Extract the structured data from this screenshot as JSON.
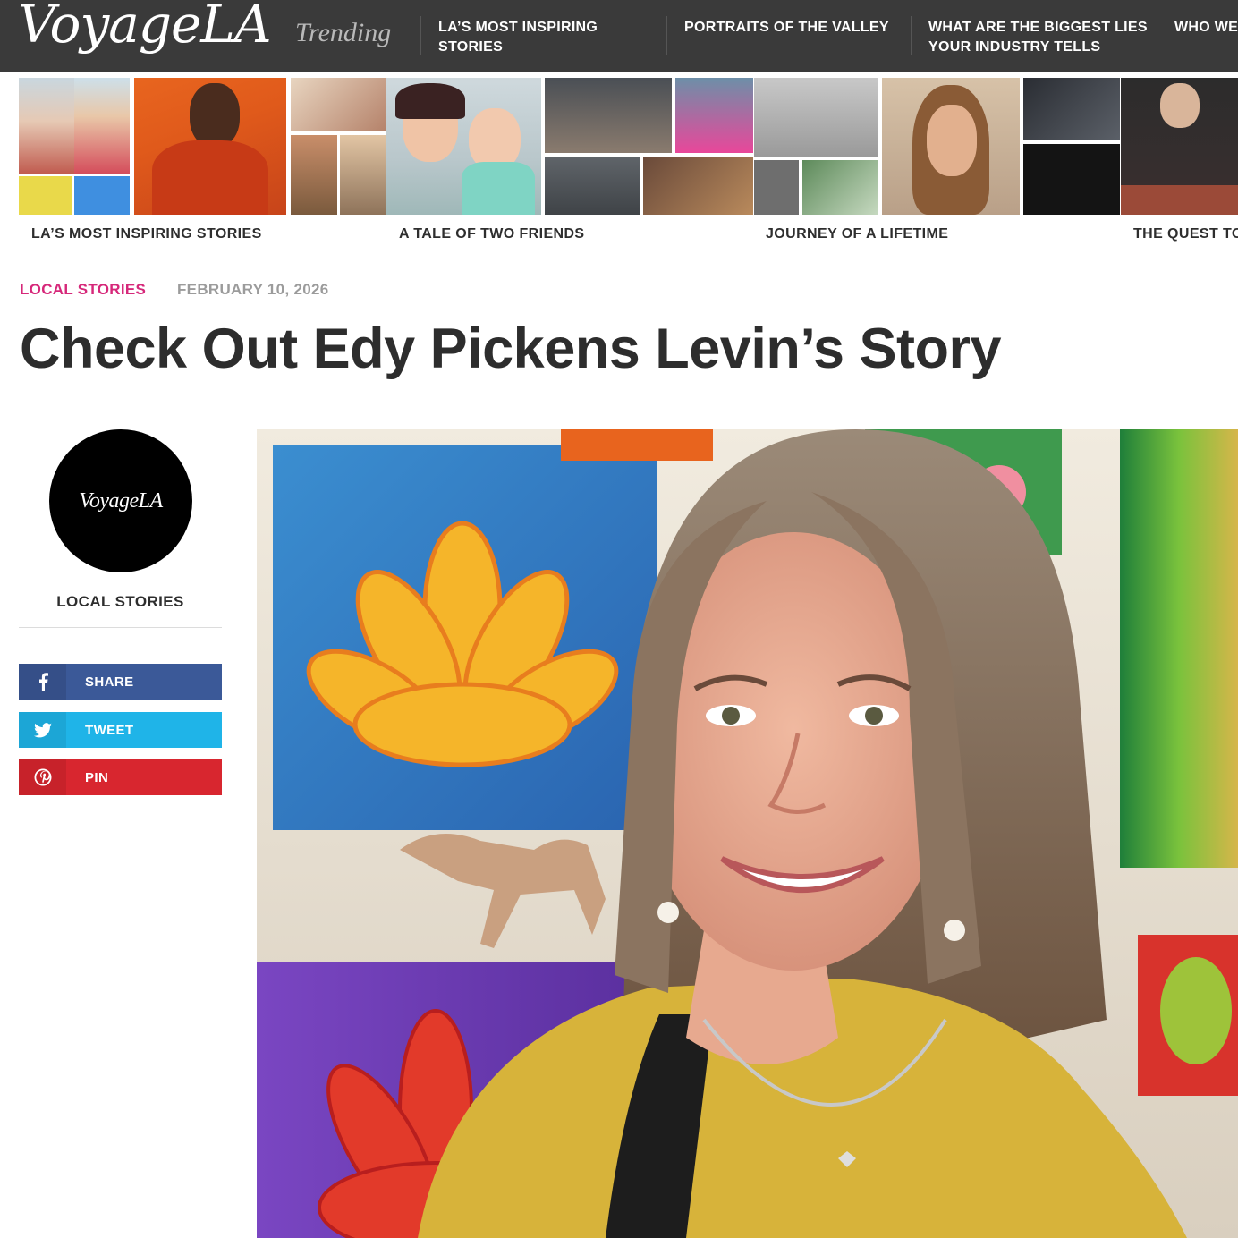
{
  "header": {
    "logo": "VoyageLA",
    "trending_label": "Trending",
    "nav": [
      {
        "label": "LA’S MOST INSPIRING STORIES"
      },
      {
        "label": "PORTRAITS OF THE VALLEY"
      },
      {
        "label": "WHAT ARE THE BIGGEST LIES YOUR INDUSTRY TELLS"
      },
      {
        "label": "WHO WE THE WO"
      }
    ]
  },
  "trending_strip": {
    "captions": [
      {
        "label": "LA’S MOST INSPIRING STORIES"
      },
      {
        "label": "A TALE OF TWO FRIENDS"
      },
      {
        "label": "JOURNEY OF A LIFETIME"
      },
      {
        "label": "THE QUEST TO"
      }
    ]
  },
  "article": {
    "category": "LOCAL STORIES",
    "date": "FEBRUARY 10, 2026",
    "title": "Check Out Edy Pickens Levin’s Story"
  },
  "sidebar": {
    "avatar_text": "VoyageLA",
    "label": "LOCAL STORIES",
    "share_buttons": [
      {
        "label": "SHARE",
        "icon": "facebook-icon",
        "color": "#3b5998"
      },
      {
        "label": "TWEET",
        "icon": "twitter-icon",
        "color": "#1fb4e8"
      },
      {
        "label": "PIN",
        "icon": "pinterest-icon",
        "color": "#d8262f"
      }
    ]
  },
  "colors": {
    "nav_bg": "#3a3a3a",
    "category": "#d6287a",
    "date": "#9b9b9b"
  }
}
